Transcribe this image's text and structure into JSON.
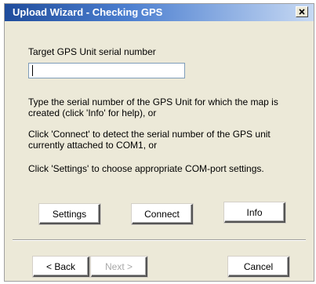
{
  "window": {
    "title": "Upload Wizard - Checking GPS",
    "close_icon": "close-icon"
  },
  "form": {
    "serial_label": "Target GPS Unit serial number",
    "serial_value": ""
  },
  "instructions": {
    "line1a": "Type the serial number of the GPS Unit for which the map is",
    "line1b": "created (click 'Info' for help), or",
    "line2a": "Click 'Connect' to detect the serial number of the GPS unit",
    "line2b": "currently attached to COM1, or",
    "line3": "Click 'Settings' to choose appropriate COM-port settings."
  },
  "actions": {
    "settings": "Settings",
    "connect": "Connect",
    "info": "Info"
  },
  "nav": {
    "back": "< Back",
    "next": "Next >",
    "cancel": "Cancel"
  }
}
